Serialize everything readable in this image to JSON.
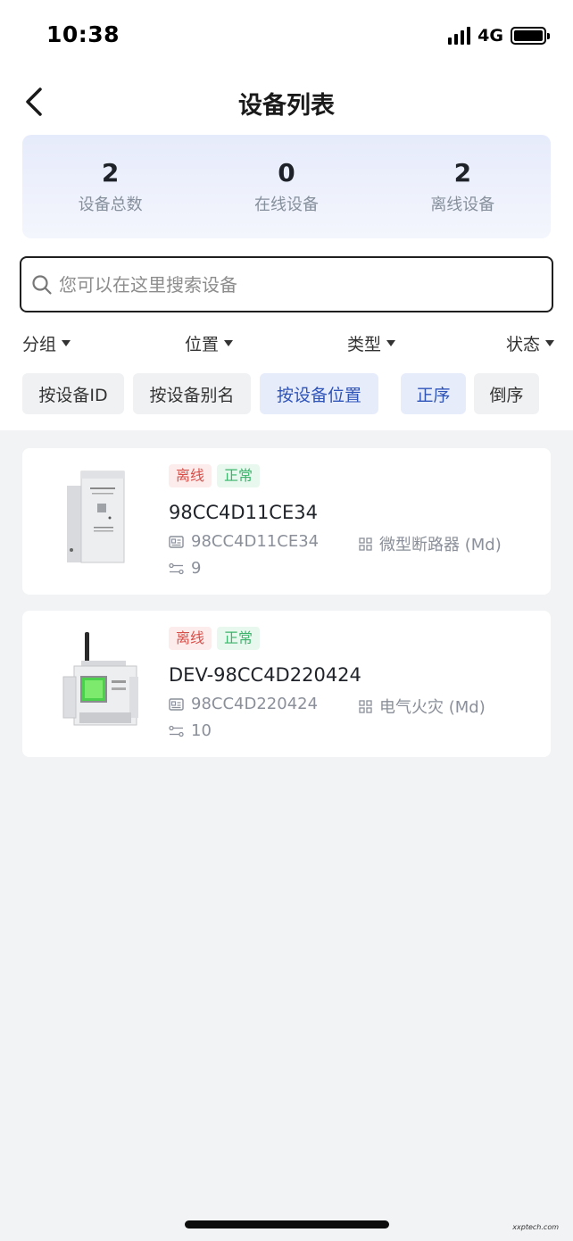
{
  "status_bar": {
    "time": "10:38",
    "network": "4G"
  },
  "header": {
    "title": "设备列表"
  },
  "stats": [
    {
      "value": "2",
      "label": "设备总数"
    },
    {
      "value": "0",
      "label": "在线设备"
    },
    {
      "value": "2",
      "label": "离线设备"
    }
  ],
  "search": {
    "placeholder": "您可以在这里搜索设备",
    "value": ""
  },
  "filters": [
    "分组",
    "位置",
    "类型",
    "状态"
  ],
  "sort_by": [
    "按设备ID",
    "按设备别名",
    "按设备位置"
  ],
  "sort_by_selected": "按设备位置",
  "order": [
    "正序",
    "倒序"
  ],
  "order_selected": "正序",
  "devices": [
    {
      "status": "离线",
      "health": "正常",
      "name": "98CC4D11CE34",
      "id": "98CC4D11CE34",
      "type": "微型断路器 (Md)",
      "count": "9"
    },
    {
      "status": "离线",
      "health": "正常",
      "name": "DEV-98CC4D220424",
      "id": "98CC4D220424",
      "type": "电气火灾 (Md)",
      "count": "10"
    }
  ],
  "watermark": "xxptech.com"
}
